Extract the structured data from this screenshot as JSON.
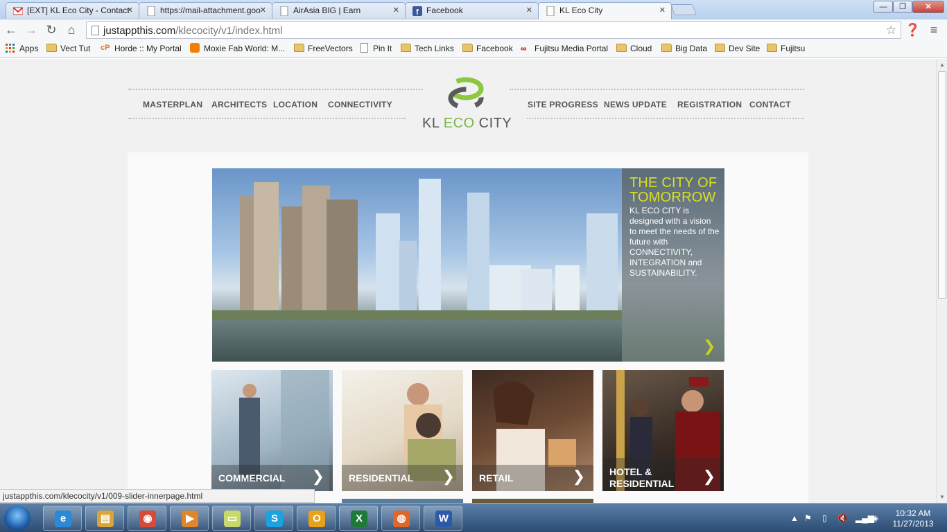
{
  "browser": {
    "tabs": [
      {
        "label": "[EXT] KL Eco City - Contact",
        "icon": "gmail-icon",
        "active": false
      },
      {
        "label": "https://mail-attachment.goo",
        "icon": "page-icon",
        "active": false
      },
      {
        "label": "AirAsia BIG | Earn",
        "icon": "page-icon",
        "active": false
      },
      {
        "label": "Facebook",
        "icon": "facebook-icon",
        "active": false
      },
      {
        "label": "KL Eco City",
        "icon": "page-icon",
        "active": true
      }
    ],
    "window_controls": {
      "minimize": "—",
      "maximize": "❐",
      "close": "✕"
    },
    "url": {
      "host": "justappthis.com",
      "path": "/klecocity/v1/index.html"
    },
    "bookmarks": [
      {
        "label": "Apps",
        "icon": "apps-grid-icon"
      },
      {
        "label": "Vect Tut",
        "icon": "folder-icon"
      },
      {
        "label": "Horde :: My Portal",
        "icon": "cpanel-icon"
      },
      {
        "label": "Moxie Fab World: M...",
        "icon": "blogger-icon"
      },
      {
        "label": "FreeVectors",
        "icon": "folder-icon"
      },
      {
        "label": "Pin It",
        "icon": "page-icon"
      },
      {
        "label": "Tech Links",
        "icon": "folder-icon"
      },
      {
        "label": "Facebook",
        "icon": "folder-icon"
      },
      {
        "label": "Fujitsu Media Portal",
        "icon": "fujitsu-icon"
      },
      {
        "label": "Cloud",
        "icon": "folder-icon"
      },
      {
        "label": "Big Data",
        "icon": "folder-icon"
      },
      {
        "label": "Dev Site",
        "icon": "folder-icon"
      },
      {
        "label": "Fujitsu",
        "icon": "folder-icon"
      }
    ],
    "status_url": "justappthis.com/klecocity/v1/009-slider-innerpage.html"
  },
  "site": {
    "nav_left": [
      "MASTERPLAN",
      "ARCHITECTS",
      "LOCATION",
      "CONNECTIVITY"
    ],
    "nav_right": [
      "SITE PROGRESS",
      "NEWS UPDATE",
      "REGISTRATION",
      "CONTACT"
    ],
    "logo": {
      "kl": "KL ",
      "eco": "ECO",
      "city": " CITY"
    },
    "hero": {
      "title": "THE CITY OF TOMORROW",
      "text": "KL ECO CITY is designed with a vision to meet the needs of the future with CONNECTIVITY, INTEGRATION and SUSTAINABILITY.",
      "arrow": "❯"
    },
    "tiles": [
      {
        "label": "COMMERCIAL"
      },
      {
        "label": "RESIDENTIAL"
      },
      {
        "label": "RETAIL"
      },
      {
        "label": "HOTEL & RESIDENTIAL"
      }
    ]
  },
  "taskbar": {
    "apps": [
      {
        "name": "internet-explorer-icon",
        "glyph": "e",
        "color": "#2a8ad8"
      },
      {
        "name": "file-explorer-icon",
        "glyph": "▤",
        "color": "#d9a53a"
      },
      {
        "name": "chrome-icon",
        "glyph": "◉",
        "color": "#d64a3a"
      },
      {
        "name": "media-player-icon",
        "glyph": "▶",
        "color": "#e0862a"
      },
      {
        "name": "sticky-notes-icon",
        "glyph": "▭",
        "color": "#c9d86a"
      },
      {
        "name": "skype-icon",
        "glyph": "S",
        "color": "#1aa3e0"
      },
      {
        "name": "outlook-icon",
        "glyph": "O",
        "color": "#e8a21a"
      },
      {
        "name": "excel-icon",
        "glyph": "X",
        "color": "#1f7a3a"
      },
      {
        "name": "firefox-icon",
        "glyph": "◍",
        "color": "#e0662a"
      },
      {
        "name": "word-icon",
        "glyph": "W",
        "color": "#2a5aa8"
      }
    ],
    "time": "10:32 AM",
    "date": "11/27/2013"
  }
}
